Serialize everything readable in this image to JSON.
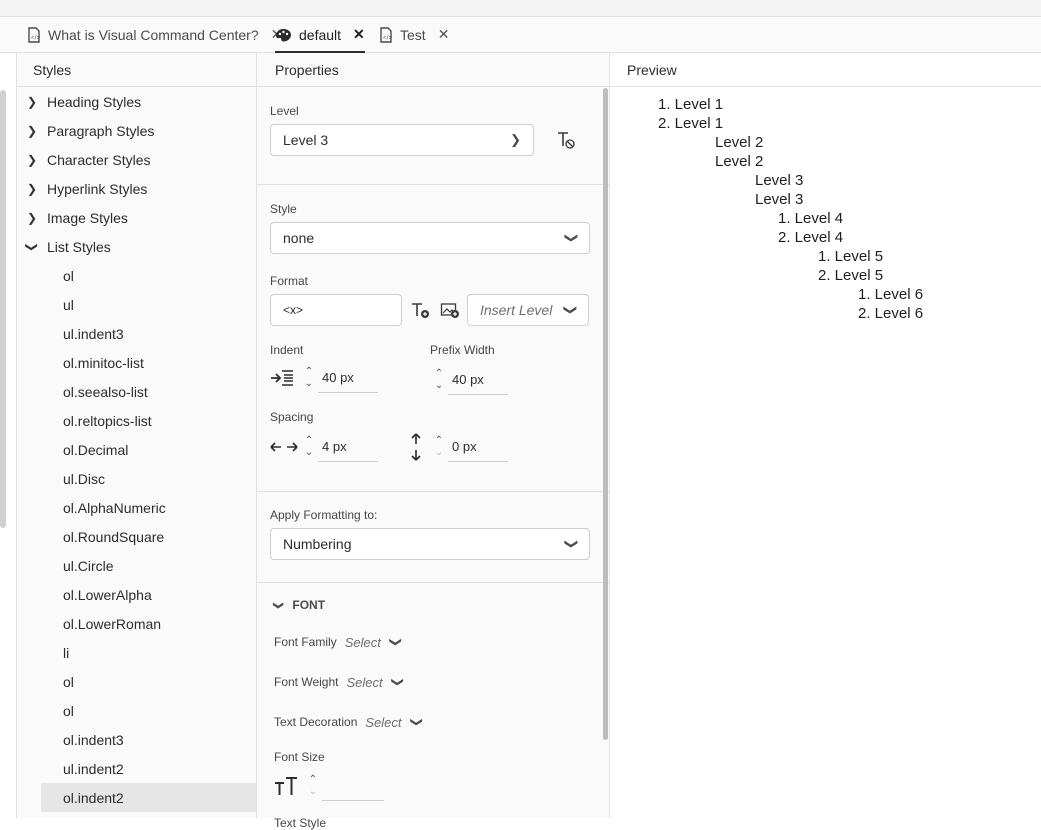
{
  "tabs": [
    {
      "label": "What is Visual Command Center?",
      "icon": "document-html-icon"
    },
    {
      "label": "default",
      "icon": "palette-icon"
    },
    {
      "label": "Test",
      "icon": "document-html-icon"
    }
  ],
  "styles_panel": {
    "title": "Styles",
    "groups": [
      "Heading Styles",
      "Paragraph Styles",
      "Character Styles",
      "Hyperlink Styles",
      "Image Styles",
      "List Styles"
    ],
    "list_items": [
      "ol",
      "ul",
      "ul.indent3",
      "ol.minitoc-list",
      "ol.seealso-list",
      "ol.reltopics-list",
      "ol.Decimal",
      "ul.Disc",
      "ol.AlphaNumeric",
      "ol.RoundSquare",
      "ul.Circle",
      "ol.LowerAlpha",
      "ol.LowerRoman",
      "li",
      "ol",
      "ol",
      "ol.indent3",
      "ul.indent2",
      "ol.indent2"
    ]
  },
  "properties_panel": {
    "title": "Properties",
    "level_label": "Level",
    "level_value": "Level 3",
    "style_label": "Style",
    "style_value": "none",
    "format_label": "Format",
    "format_value": "<x>",
    "insert_level_placeholder": "Insert Level",
    "indent_label": "Indent",
    "indent_value": "40 px",
    "prefix_width_label": "Prefix Width",
    "prefix_width_value": "40 px",
    "spacing_label": "Spacing",
    "spacing_h_value": "4 px",
    "spacing_v_value": "0 px",
    "apply_label": "Apply Formatting to:",
    "apply_value": "Numbering",
    "font_section": "FONT",
    "font_family_label": "Font Family",
    "font_weight_label": "Font Weight",
    "text_decoration_label": "Text Decoration",
    "select_placeholder": "Select",
    "font_size_label": "Font Size",
    "text_style_label": "Text Style"
  },
  "preview_panel": {
    "title": "Preview",
    "lines": [
      "1. Level 1",
      "2. Level 1",
      "Level 2",
      "Level 2",
      "Level 3",
      "Level 3",
      "1. Level 4",
      "2. Level 4",
      "1. Level 5",
      "2. Level 5",
      "1. Level 6",
      "2. Level 6"
    ]
  }
}
